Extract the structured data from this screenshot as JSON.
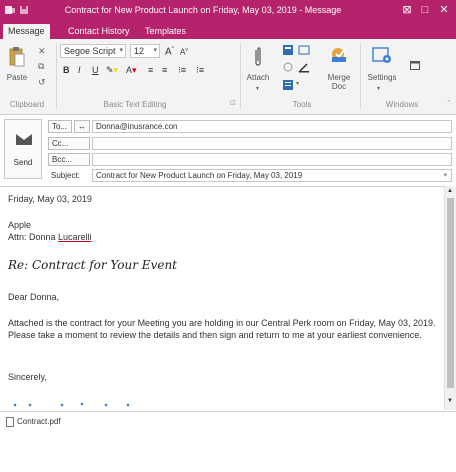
{
  "window": {
    "title": "Contract for New Product Launch on Friday, May 03, 2019 - Message",
    "buttons": {
      "minimize": "⊠",
      "maximize": "□",
      "close": "✕"
    }
  },
  "ribbon_tabs": [
    {
      "label": "Message",
      "active": true
    },
    {
      "label": "Contact History",
      "active": false
    },
    {
      "label": "Templates",
      "active": false
    }
  ],
  "ribbon": {
    "clipboard": {
      "paste_label": "Paste",
      "group_label": "Clipboard"
    },
    "basic_text": {
      "font_name": "Segoe Script",
      "font_size": "12",
      "group_label": "Basic Text Editing"
    },
    "tools": {
      "attach_label": "Attach",
      "merge_doc_label": "Merge\nDoc",
      "group_label": "Tools"
    },
    "windows": {
      "settings_label": "Settings",
      "group_label": "Windows"
    }
  },
  "header": {
    "send_label": "Send",
    "to_button": "To...",
    "to_value": "Donna@inusrance.con",
    "cc_button": "Cc...",
    "cc_value": "",
    "bcc_button": "Bcc...",
    "bcc_value": "",
    "subject_label": "Subject:",
    "subject_value": "Contract for New Product Launch on Friday, May 03, 2019"
  },
  "body": {
    "date": "Friday, May 03, 2019",
    "company": "Apple",
    "attn_prefix": "Attn:  Donna ",
    "attn_name": "Lucarelli",
    "re_prefix": "Re: ",
    "re_text": "Contract for Your Event",
    "greeting": "Dear Donna,",
    "paragraph": "Attached is the contract for your Meeting you are holding in our Central Perk room on Friday, May 03, 2019.  Please take a moment to review the details and then sign and return to me at your earliest convenience.",
    "closing": "Sincerely,"
  },
  "attachment": {
    "filename": "Contract.pdf"
  },
  "colors": {
    "accent": "#b4236b",
    "ribbon_bg": "#f3f3f3"
  }
}
